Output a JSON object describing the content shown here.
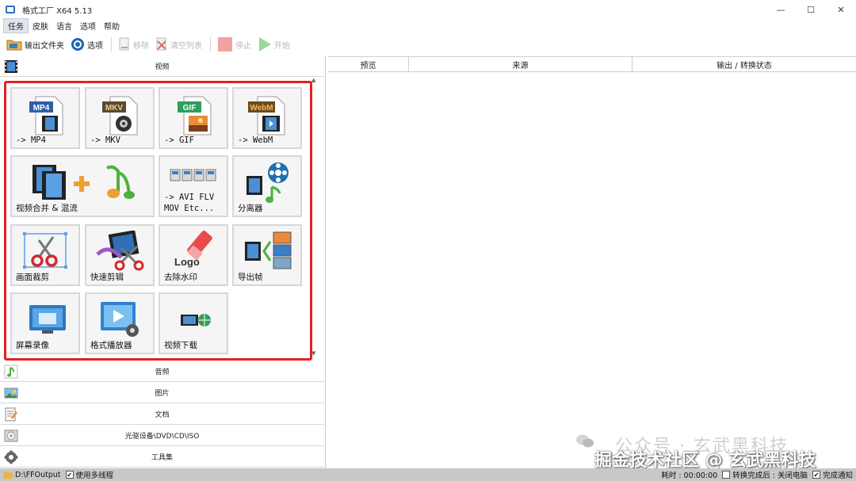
{
  "window": {
    "title": "格式工厂 X64 5.13",
    "minimize": "—",
    "maximize": "☐",
    "close": "✕"
  },
  "menu": [
    "任务",
    "皮肤",
    "语言",
    "选项",
    "帮助"
  ],
  "toolbar": {
    "output_folder": "输出文件夹",
    "options": "选项",
    "remove": "移除",
    "clear_list": "清空列表",
    "stop": "停止",
    "start": "开始"
  },
  "categories": {
    "video": "视频",
    "audio": "音频",
    "image": "图片",
    "document": "文档",
    "disc": "光驱设备\\DVD\\CD\\ISO",
    "tools": "工具集"
  },
  "video_tiles": [
    {
      "label": "-> MP4",
      "badge": "MP4"
    },
    {
      "label": "-> MKV",
      "badge": "MKV"
    },
    {
      "label": "-> GIF",
      "badge": "GIF"
    },
    {
      "label": "-> WebM",
      "badge": "WebM"
    },
    {
      "label": "视频合并 & 混流"
    },
    {
      "label": "-> AVI FLV\nMOV Etc..."
    },
    {
      "label": "分离器"
    },
    {
      "label": "画面裁剪"
    },
    {
      "label": "快速剪辑"
    },
    {
      "label": "去除水印",
      "logo_text": "Logo"
    },
    {
      "label": "导出帧"
    },
    {
      "label": "屏幕录像"
    },
    {
      "label": "格式播放器"
    },
    {
      "label": "视频下载"
    }
  ],
  "task_list": {
    "columns": [
      "预览",
      "来源",
      "输出 / 转换状态"
    ]
  },
  "status": {
    "output_path": "D:\\FFOutput",
    "multithread": "使用多线程",
    "elapsed": "耗时 : 00:00:00",
    "after_convert": "转换完成后 : 关闭电脑",
    "notify": "完成通知"
  },
  "watermark": {
    "line1": "公众号 · 玄武黑科技",
    "line2": "掘金技术社区 @ 玄武黑科技"
  },
  "colors": {
    "highlight_frame": "#e5201f",
    "tile_bg": "#f5f5f5",
    "statusbar": "#c8c8c8"
  }
}
